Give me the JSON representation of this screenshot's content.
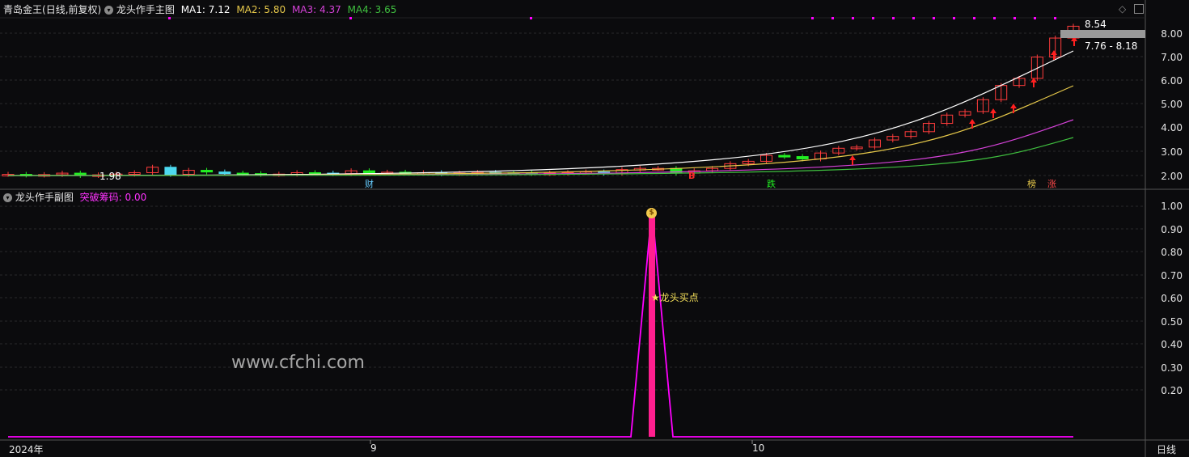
{
  "colors": {
    "bg": "#0b0b0d",
    "ma1": "#ffffff",
    "ma2": "#e6c84a",
    "ma3": "#d542d8",
    "ma4": "#3fbf3f",
    "up": "#ff3c3c",
    "down": "#22ee22",
    "magenta": "#ff00ff",
    "pink": "#ff1f8f"
  },
  "main_panel": {
    "stock_name": "青岛金王",
    "period": "(日线,前复权)",
    "indicator_name": "龙头作手主图",
    "ma": [
      {
        "label": "MA1:",
        "value": "7.12",
        "color": "#ffffff"
      },
      {
        "label": "MA2:",
        "value": "5.80",
        "color": "#e6c84a"
      },
      {
        "label": "MA3:",
        "value": "4.37",
        "color": "#d542d8"
      },
      {
        "label": "MA4:",
        "value": "3.65",
        "color": "#3fbf3f"
      }
    ],
    "y_ticks": [
      "8.00",
      "7.00",
      "6.00",
      "5.00",
      "4.00",
      "3.00",
      "2.00"
    ],
    "high_label": "8.54",
    "range_label": "7.76 - 8.18",
    "low_label": "1.98",
    "markers": [
      {
        "text": "财",
        "color": "#66ccff"
      },
      {
        "text": "B",
        "color": "#ff2a2a"
      },
      {
        "text": "跌",
        "color": "#22ee22"
      },
      {
        "text": "榜",
        "color": "#e6c84a"
      },
      {
        "text": "涨",
        "color": "#ff4a4a"
      }
    ]
  },
  "sub_panel": {
    "indicator_name": "龙头作手副图",
    "value_label": "突破筹码:",
    "value": "0.00",
    "y_ticks": [
      "1.00",
      "0.90",
      "0.80",
      "0.70",
      "0.60",
      "0.50",
      "0.40",
      "0.30",
      "0.20"
    ],
    "buy_label": "★龙头买点",
    "watermark": "www.cfchi.com"
  },
  "x_axis": {
    "labels": [
      "2024年",
      "9",
      "10"
    ]
  },
  "period_button": "日线"
}
